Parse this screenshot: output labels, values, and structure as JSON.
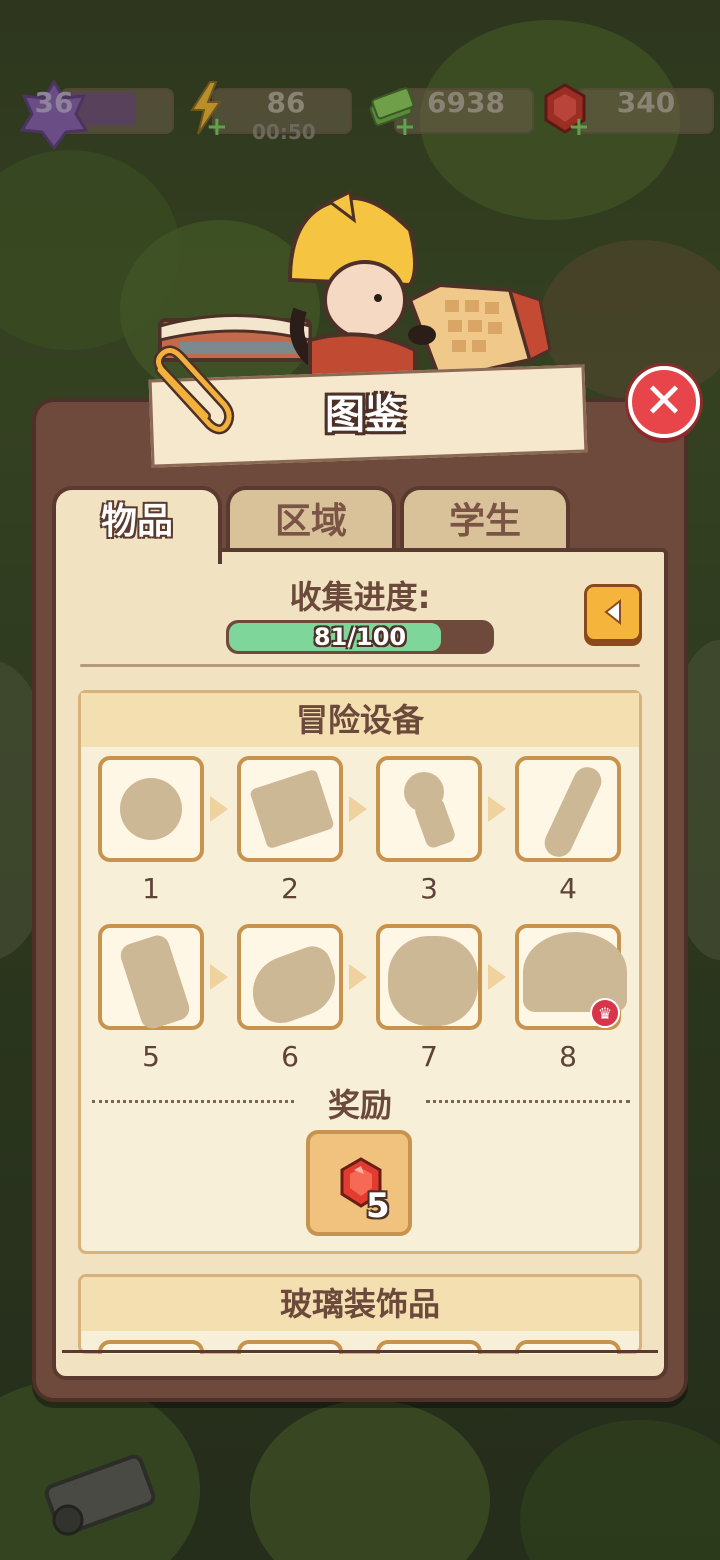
{
  "hud": {
    "level": "36",
    "energy": "86",
    "energy_timer": "00:50",
    "cash": "6938",
    "gems": "340"
  },
  "modal": {
    "title": "图鉴",
    "close_icon": "close-x-icon"
  },
  "tabs": [
    {
      "label": "物品",
      "active": true
    },
    {
      "label": "区域",
      "active": false
    },
    {
      "label": "学生",
      "active": false
    }
  ],
  "progress": {
    "label": "收集进度:",
    "text": "81/100",
    "value": 81,
    "max": 100
  },
  "categories": [
    {
      "title": "冒险设备",
      "items": [
        "1",
        "2",
        "3",
        "4",
        "5",
        "6",
        "7",
        "8"
      ],
      "reward_label": "奖励",
      "reward_count": "5"
    },
    {
      "title": "玻璃装饰品"
    }
  ],
  "colors": {
    "progress_fill": "#7fd69b",
    "close_button": "#e8454b",
    "panel": "#f1e3c2",
    "frame": "#6e4a3c"
  }
}
